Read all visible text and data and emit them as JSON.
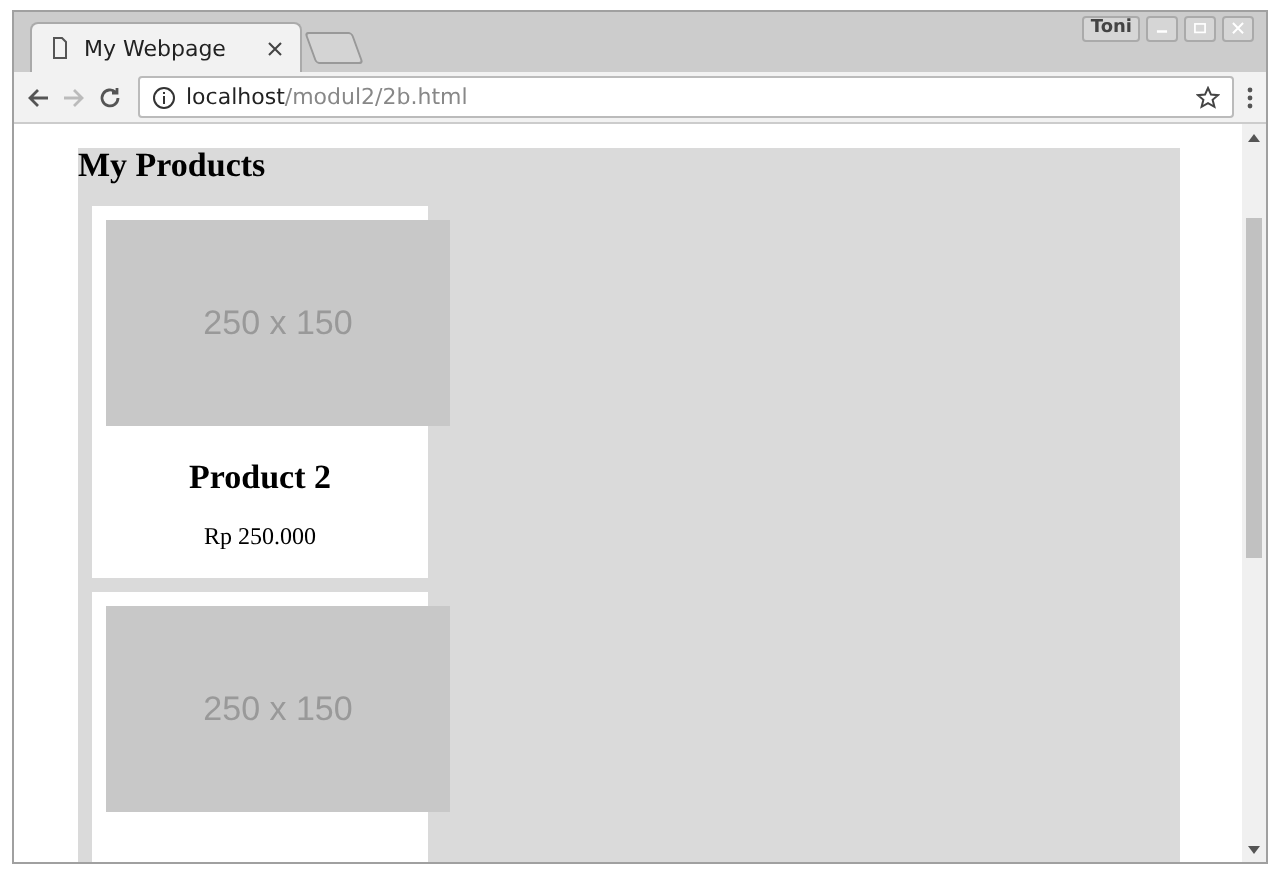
{
  "window": {
    "user": "Toni"
  },
  "tabs": [
    {
      "title": "My Webpage",
      "selected": true
    }
  ],
  "address_bar": {
    "host": "localhost",
    "path": "/modul2/2b.html"
  },
  "page": {
    "heading": "My Products",
    "products": [
      {
        "image_label": "250 x 150",
        "name": "Product 2",
        "price": "Rp 250.000"
      },
      {
        "image_label": "250 x 150"
      }
    ]
  }
}
